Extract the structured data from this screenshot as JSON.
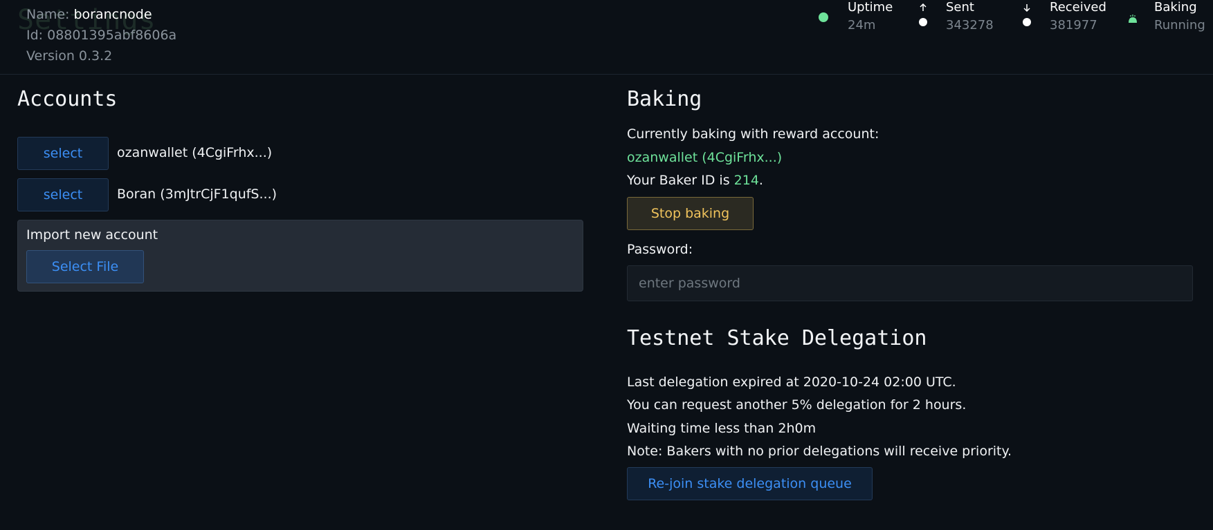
{
  "header": {
    "ghost_title": "Settings",
    "name_label": "Name: ",
    "name_value": "borancnode",
    "id_text": "Id: 08801395abf8606a",
    "version_text": "Version 0.3.2"
  },
  "stats": {
    "uptime": {
      "label": "Uptime",
      "value": "24m",
      "icon": "status-dot",
      "color": "#6ee29a"
    },
    "sent": {
      "label": "Sent",
      "value": "343278",
      "icon": "arrow-up-dot"
    },
    "received": {
      "label": "Received",
      "value": "381977",
      "icon": "arrow-down-dot"
    },
    "baking": {
      "label": "Baking",
      "value": "Running",
      "icon": "bread-icon",
      "color": "#6ee29a"
    }
  },
  "accounts": {
    "title": "Accounts",
    "items": [
      {
        "button": "select",
        "label": "ozanwallet (4CgiFrhx...)"
      },
      {
        "button": "select",
        "label": "Boran (3mJtrCjF1qufS...)"
      }
    ],
    "import_label": "Import new account",
    "import_button": "Select File"
  },
  "baking": {
    "title": "Baking",
    "reward_text": "Currently baking with reward account:",
    "reward_account": "ozanwallet (4CgiFrhx...)",
    "baker_id_prefix": "Your Baker ID is ",
    "baker_id": "214",
    "baker_id_suffix": ".",
    "stop_button": "Stop baking",
    "password_label": "Password:",
    "password_placeholder": "enter password"
  },
  "delegation": {
    "title": "Testnet Stake Delegation",
    "line1": "Last delegation expired at 2020-10-24 02:00 UTC.",
    "line2": "You can request another 5% delegation for 2 hours.",
    "line3": "Waiting time less than 2h0m",
    "line4": "Note: Bakers with no prior delegations will receive priority.",
    "rejoin_button": "Re-join stake delegation queue"
  },
  "colors": {
    "background": "#0b1016",
    "accent_blue": "#3c8ff5",
    "accent_green": "#6ee29a",
    "warning": "#f0c35c"
  }
}
